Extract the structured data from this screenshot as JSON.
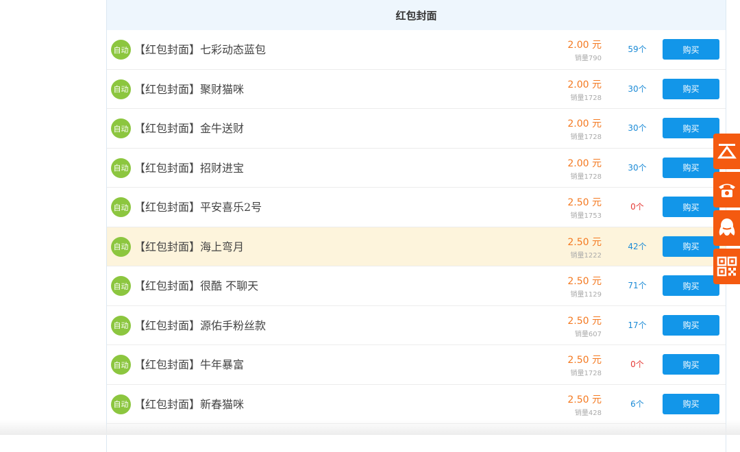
{
  "header": {
    "title": "红包封面"
  },
  "labels": {
    "badge": "自动",
    "buy": "购买"
  },
  "products": [
    {
      "name": "【红包封面】七彩动态蓝包",
      "price": "2.00 元",
      "sales": "销量790",
      "stock": "59个"
    },
    {
      "name": "【红包封面】聚财猫咪",
      "price": "2.00 元",
      "sales": "销量1728",
      "stock": "30个"
    },
    {
      "name": "【红包封面】金牛送财",
      "price": "2.00 元",
      "sales": "销量1728",
      "stock": "30个"
    },
    {
      "name": "【红包封面】招财进宝",
      "price": "2.00 元",
      "sales": "销量1728",
      "stock": "30个"
    },
    {
      "name": "【红包封面】平安喜乐2号",
      "price": "2.50 元",
      "sales": "销量1753",
      "stock": "0个"
    },
    {
      "name": "【红包封面】海上弯月",
      "price": "2.50 元",
      "sales": "销量1222",
      "stock": "42个"
    },
    {
      "name": "【红包封面】很酷 不聊天",
      "price": "2.50 元",
      "sales": "销量1129",
      "stock": "71个"
    },
    {
      "name": "【红包封面】源佑手粉丝款",
      "price": "2.50 元",
      "sales": "销量607",
      "stock": "17个"
    },
    {
      "name": "【红包封面】牛年暴富",
      "price": "2.50 元",
      "sales": "销量1728",
      "stock": "0个"
    },
    {
      "name": "【红包封面】新春猫咪",
      "price": "2.50 元",
      "sales": "销量428",
      "stock": "6个"
    }
  ],
  "highlighted_index": 5,
  "colors": {
    "accent": "#1296e9",
    "price": "#f47920",
    "badge": "#8cc63f",
    "zero_stock": "#e53935",
    "sidebar": "#f45a10"
  },
  "side_toolbar": [
    {
      "icon": "back-to-top-icon"
    },
    {
      "icon": "phone-icon"
    },
    {
      "icon": "qq-icon"
    },
    {
      "icon": "qr-code-icon"
    }
  ]
}
